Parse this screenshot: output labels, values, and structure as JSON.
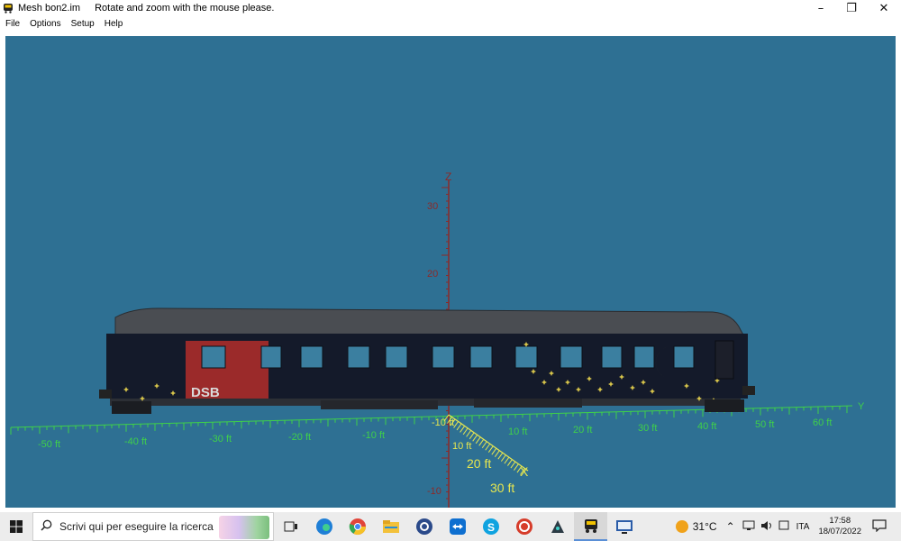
{
  "window": {
    "app_title": "Mesh bon2.im",
    "hint": "Rotate and zoom with the mouse please.",
    "controls": {
      "minimize": "–",
      "restore": "❐",
      "close": "✕"
    }
  },
  "menu": [
    "File",
    "Options",
    "Setup",
    "Help"
  ],
  "viewport": {
    "background": "#2e7093",
    "axis_z_label": "Z",
    "axis_x_label": "X",
    "axis_y_label": "Y",
    "z_ticks": [
      "30",
      "20",
      "-10"
    ],
    "y_ticks": [
      "-50 ft",
      "-40 ft",
      "-30 ft",
      "-20 ft",
      "-10 ft",
      "10 ft",
      "20 ft",
      "30 ft",
      "40 ft",
      "50 ft",
      "60 ft"
    ],
    "x_ticks": [
      "-10 ft",
      "10 ft",
      "20 ft",
      "30 ft"
    ],
    "train_logo": "DSB",
    "colors": {
      "z_axis": "#8b2a2a",
      "y_axis": "#3fd04a",
      "x_axis": "#e6e650",
      "train_body": "#141a2a",
      "logo_panel": "#9b2a2a"
    }
  },
  "taskbar": {
    "search_placeholder": "Scrivi qui per eseguire la ricerca",
    "icons": [
      "task-view-icon",
      "edge-icon",
      "chrome-icon",
      "file-explorer-icon",
      "github-icon",
      "teamviewer-icon",
      "skype-icon",
      "ccleaner-icon",
      "vpn-icon",
      "trainz-icon",
      "monitor-icon"
    ],
    "weather": "31°C",
    "language": "ITA",
    "time": "17:58",
    "date": "18/07/2022"
  }
}
